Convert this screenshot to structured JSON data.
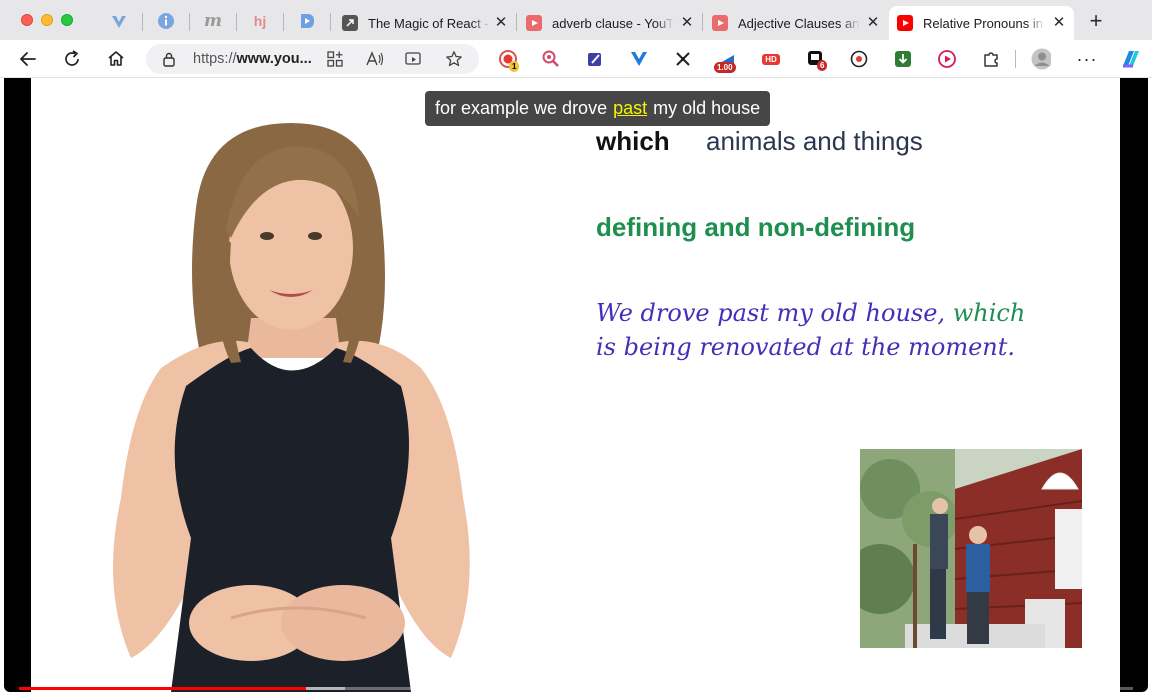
{
  "browser": {
    "tabs": [
      {
        "title": "The Magic of React -",
        "favicon": "external-link-icon",
        "active": false
      },
      {
        "title": "adverb clause - YouTube",
        "favicon": "youtube-icon",
        "active": false
      },
      {
        "title": "Adjective Clauses and",
        "favicon": "youtube-icon",
        "active": false
      },
      {
        "title": "Relative Pronouns in",
        "favicon": "youtube-icon",
        "active": true
      }
    ],
    "pinned_tabs": [
      "vivaldi-icon",
      "info-icon",
      "m-letter-icon",
      "hj-icon",
      "d-arrow-icon"
    ],
    "url": {
      "scheme": "https://",
      "host": "www.you..."
    },
    "extension_badges": {
      "red_circle": "1",
      "speed": "1.00",
      "hd": "HD",
      "counter": "6"
    },
    "colors": {
      "accent_red": "#ff0000",
      "progress_red": "#ff0000",
      "slide_green": "#1e8f4e",
      "slide_purple": "#4330b8"
    }
  },
  "video": {
    "caption": {
      "before": "for example we drove",
      "highlight": "past",
      "after": "my old house"
    },
    "slide": {
      "which": "which",
      "animals": "animals and things",
      "defining": "defining and non-defining",
      "sentence_a": "We drove past my old house,",
      "sentence_which": "which",
      "sentence_b": "is being renovated at the moment."
    },
    "progress": {
      "played_fraction": 0.258,
      "buffered_fraction": 0.035
    }
  }
}
